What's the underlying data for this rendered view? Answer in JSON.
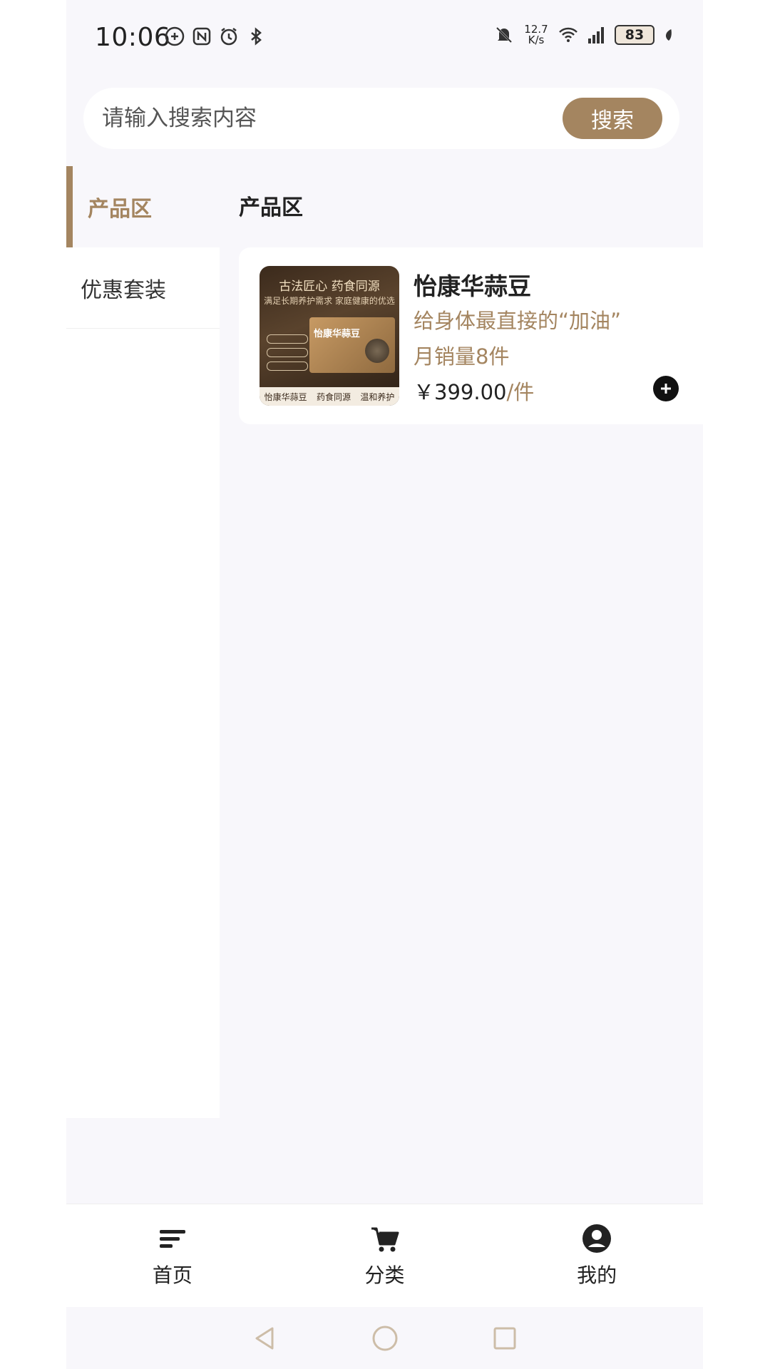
{
  "status_bar": {
    "time": "10:06",
    "net_speed_value": "12.7",
    "net_speed_unit": "K/s",
    "network_type": "6",
    "battery_level": "83"
  },
  "search": {
    "placeholder": "请输入搜索内容",
    "button_label": "搜索"
  },
  "sidebar": {
    "items": [
      {
        "label": "产品区",
        "active": true
      },
      {
        "label": "优惠套装",
        "active": false
      }
    ]
  },
  "main": {
    "section_title": "产品区",
    "products": [
      {
        "name": "怡康华蒜豆",
        "slogan": "给身体最直接的“加油”",
        "sales": "月销量8件",
        "price": "￥399.00",
        "price_unit": "/件",
        "image": {
          "headline": "古法匠心 药食同源",
          "subline": "满足长期养护需求 家庭健康的优选",
          "box_title": "怡康华蒜豆",
          "footer": [
            "怡康华蒜豆",
            "药食同源",
            "温和养护"
          ]
        }
      }
    ]
  },
  "tab_bar": {
    "tabs": [
      {
        "label": "首页",
        "icon": "menu-lines-icon"
      },
      {
        "label": "分类",
        "icon": "cart-icon"
      },
      {
        "label": "我的",
        "icon": "user-circle-icon"
      }
    ]
  },
  "colors": {
    "accent": "#a48560",
    "background": "#f8f7fb"
  }
}
